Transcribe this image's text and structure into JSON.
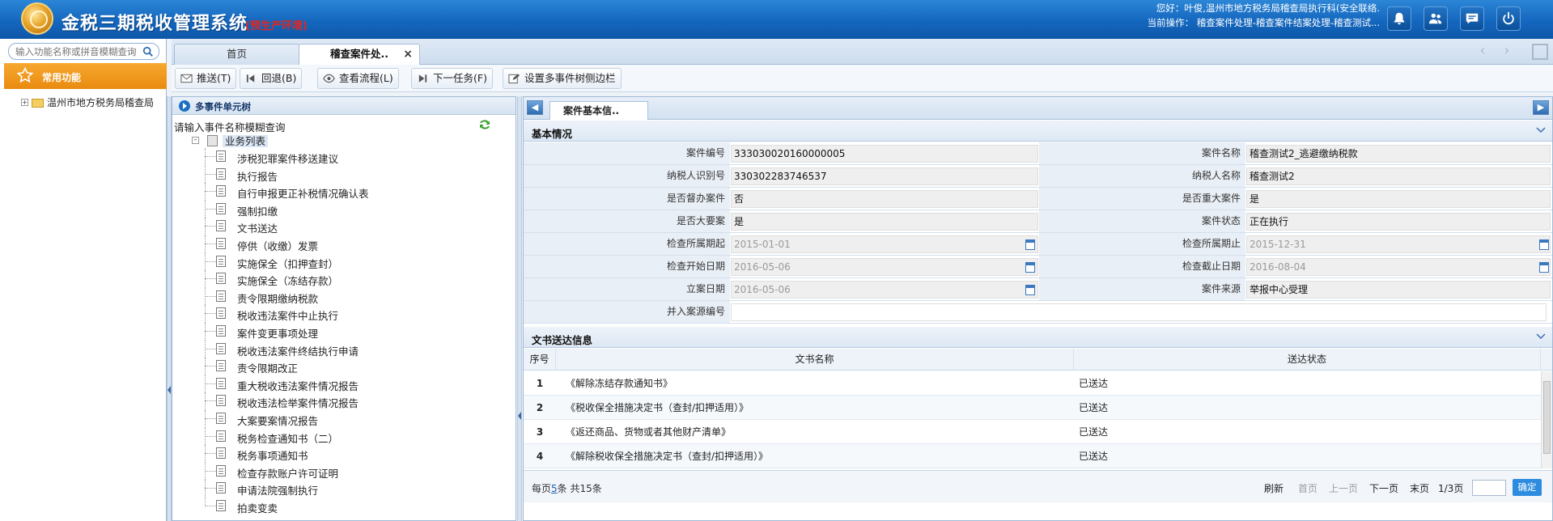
{
  "header": {
    "app_title": "金税三期税收管理系统",
    "env_tag": "(预生产环境)",
    "user_greeting": "您好：叶俊,温州市地方税务局稽查局执行科(安全联络.",
    "current_op": "当前操作： 稽查案件处理-稽查案件结案处理-稽查测试..."
  },
  "sidebar": {
    "search_placeholder": "输入功能名称或拼音模糊查询",
    "common_label": "常用功能",
    "org_node": "温州市地方税务局稽查局"
  },
  "tabs": {
    "home": "首页",
    "active": "稽查案件处..",
    "close": "×"
  },
  "toolbar": {
    "push": "推送(T)",
    "back": "回退(B)",
    "view_flow": "查看流程(L)",
    "next_task": "下一任务(F)",
    "set_sidebar": "设置多事件树侧边栏"
  },
  "tree": {
    "title": "多事件单元树",
    "query_hint": "请输入事件名称模糊查询",
    "root": "业务列表",
    "items": [
      "涉税犯罪案件移送建议",
      "执行报告",
      "自行申报更正补税情况确认表",
      "强制扣缴",
      "文书送达",
      "停供（收缴）发票",
      "实施保全（扣押查封）",
      "实施保全（冻结存款）",
      "责令限期缴纳税款",
      "税收违法案件中止执行",
      "案件变更事项处理",
      "税收违法案件终结执行申请",
      "责令限期改正",
      "重大税收违法案件情况报告",
      "税收违法检举案件情况报告",
      "大案要案情况报告",
      "税务检查通知书（二）",
      "税务事项通知书",
      "检查存款账户许可证明",
      "申请法院强制执行",
      "拍卖变卖"
    ]
  },
  "content": {
    "tab_label": "案件基本信..",
    "basic_section": "基本情况",
    "fields": {
      "case_no_label": "案件编号",
      "case_no": "333030020160000005",
      "case_name_label": "案件名称",
      "case_name": "稽查测试2_逃避缴纳税款",
      "taxpayer_id_label": "纳税人识别号",
      "taxpayer_id": "330302283746537",
      "taxpayer_name_label": "纳税人名称",
      "taxpayer_name": "稽查测试2",
      "supervised_label": "是否督办案件",
      "supervised": "否",
      "major_label": "是否重大案件",
      "major": "是",
      "big_label": "是否大要案",
      "big": "是",
      "status_label": "案件状态",
      "status": "正在执行",
      "period_start_label": "检查所属期起",
      "period_start": "2015-01-01",
      "period_end_label": "检查所属期止",
      "period_end": "2015-12-31",
      "check_start_label": "检查开始日期",
      "check_start": "2016-05-06",
      "check_end_label": "检查截止日期",
      "check_end": "2016-08-04",
      "filing_date_label": "立案日期",
      "filing_date": "2016-05-06",
      "source_label": "案件来源",
      "source": "举报中心受理",
      "merged_label": "并入案源编号",
      "merged": ""
    },
    "doc_section": "文书送达信息",
    "doc_columns": [
      "序号",
      "文书名称",
      "送达状态"
    ],
    "doc_rows": [
      {
        "no": "1",
        "name": "《解除冻结存款通知书》",
        "status": "已送达"
      },
      {
        "no": "2",
        "name": "《税收保全措施决定书（查封/扣押适用）》",
        "status": "已送达"
      },
      {
        "no": "3",
        "name": "《返还商品、货物或者其他财产清单》",
        "status": "已送达"
      },
      {
        "no": "4",
        "name": "《解除税收保全措施决定书（查封/扣押适用）》",
        "status": "已送达"
      }
    ],
    "pager": {
      "per_page_prefix": "每页",
      "per_page": "5",
      "per_page_suffix": "条 共15条",
      "refresh": "刷新",
      "first": "首页",
      "prev": "上一页",
      "next": "下一页",
      "last": "末页",
      "page_info": "1/3页",
      "go": "确定"
    }
  }
}
